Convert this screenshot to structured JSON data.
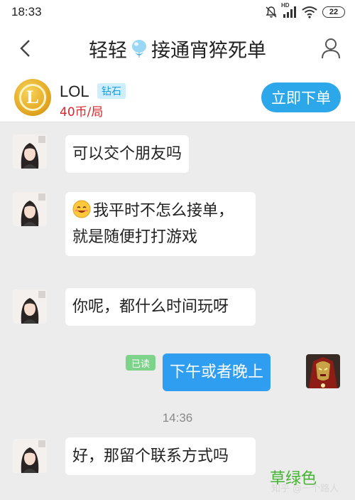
{
  "status_bar": {
    "time": "18:33",
    "battery": "22",
    "icons": [
      "mute-icon",
      "signal-icon",
      "wifi-icon",
      "battery-icon"
    ],
    "network_label": "HD"
  },
  "nav": {
    "title_left": "轻轻",
    "title_right": "接通宵猝死单",
    "title_emoji": "balloon-icon"
  },
  "order": {
    "game": "LOL",
    "rank": "钻石",
    "price": "40币/局",
    "order_button": "立即下单"
  },
  "messages": {
    "m1": "可以交个朋友吗",
    "m2": "我平时不怎么接单，就是随便打打游戏",
    "m3": "你呢，都什么时间玩呀",
    "m4": "下午或者晚上",
    "m4_status": "已读",
    "time": "14:36",
    "m5": "好，那留个联系方式吗"
  },
  "overlay": {
    "annotation": "草绿色",
    "watermark": "知乎 @一个路人"
  },
  "colors": {
    "accent": "#2ca8ea",
    "price": "#d9262c",
    "read_badge": "#7dd38a",
    "annotation": "#44b332"
  }
}
